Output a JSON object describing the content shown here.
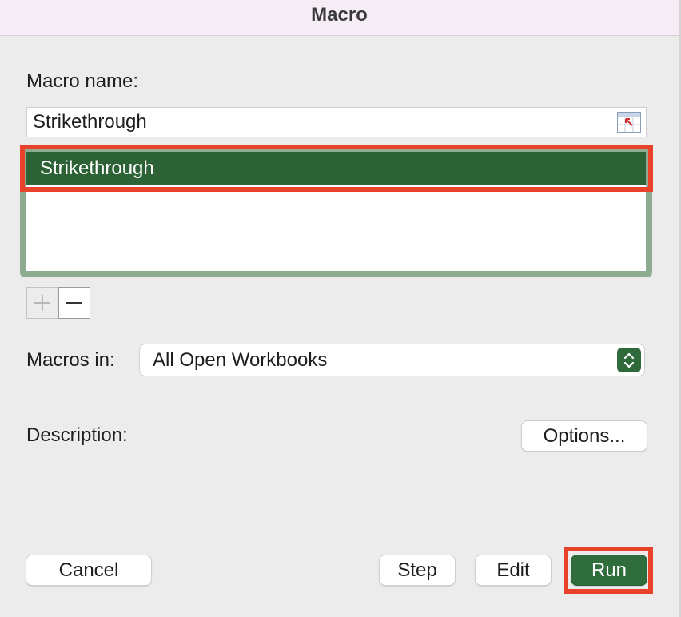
{
  "window": {
    "title": "Macro"
  },
  "macro_name": {
    "label": "Macro name:",
    "value": "Strikethrough",
    "collapse_icon": "range-select-icon"
  },
  "macro_list": {
    "items": [
      {
        "label": "Strikethrough",
        "selected": true
      }
    ],
    "add_icon": "plus-icon",
    "remove_icon": "minus-icon"
  },
  "macros_in": {
    "label": "Macros in:",
    "selected": "All Open Workbooks",
    "dropdown_icon": "up-down-chevron-icon"
  },
  "description": {
    "label": "Description:"
  },
  "buttons": {
    "options": "Options...",
    "cancel": "Cancel",
    "step": "Step",
    "edit": "Edit",
    "run": "Run"
  },
  "colors": {
    "accent": "#2d6237",
    "highlight_annotation": "#e8432a",
    "list_focus_ring": "#8eac92",
    "titlebar": "#f6edf6"
  }
}
